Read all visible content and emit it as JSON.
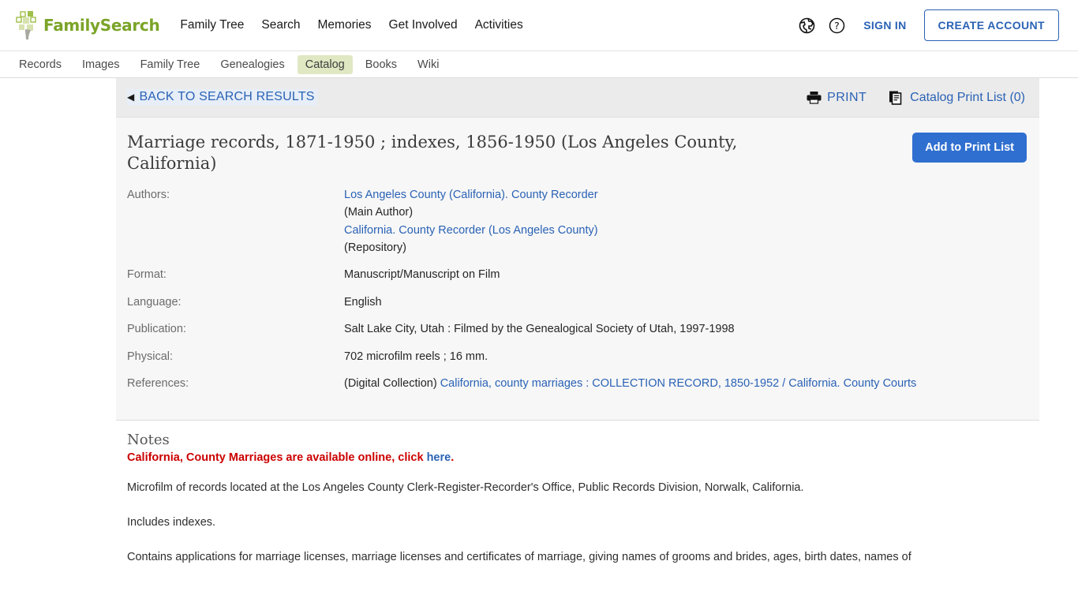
{
  "header": {
    "logo_text": "FamilySearch",
    "nav": [
      {
        "label": "Family Tree"
      },
      {
        "label": "Search"
      },
      {
        "label": "Memories"
      },
      {
        "label": "Get Involved"
      },
      {
        "label": "Activities"
      }
    ],
    "globe_icon": "globe-icon",
    "help_icon": "question-circle-icon",
    "sign_in": "SIGN IN",
    "create_account": "CREATE ACCOUNT",
    "accent_link_color": "#2a62b5",
    "logo_color": "#7ba428"
  },
  "subnav": {
    "items": [
      {
        "label": "Records",
        "active": false
      },
      {
        "label": "Images",
        "active": false
      },
      {
        "label": "Family Tree",
        "active": false
      },
      {
        "label": "Genealogies",
        "active": false
      },
      {
        "label": "Catalog",
        "active": true
      },
      {
        "label": "Books",
        "active": false
      },
      {
        "label": "Wiki",
        "active": false
      }
    ],
    "active_background": "#dfe8c2"
  },
  "toolbar": {
    "back_label": "BACK TO SEARCH RESULTS",
    "back_arrow": "◀",
    "print_label": "PRINT",
    "print_icon": "printer-icon",
    "print_list_label": "Catalog Print List (0)",
    "print_list_icon": "document-stack-icon"
  },
  "record": {
    "title": "Marriage records, 1871-1950 ; indexes, 1856-1950 (Los Angeles County, California)",
    "add_button": "Add to Print List",
    "add_button_color": "#2f6fd0",
    "fields": [
      {
        "label": "Authors:",
        "lines": [
          {
            "text": "Los Angeles County (California). County Recorder",
            "link": true
          },
          {
            "text": "(Main Author)",
            "link": false
          },
          {
            "text": "California. County Recorder (Los Angeles County)",
            "link": true
          },
          {
            "text": "(Repository)",
            "link": false
          }
        ]
      },
      {
        "label": "Format:",
        "lines": [
          {
            "text": "Manuscript/Manuscript on Film",
            "link": false
          }
        ]
      },
      {
        "label": "Language:",
        "lines": [
          {
            "text": "English",
            "link": false
          }
        ]
      },
      {
        "label": "Publication:",
        "lines": [
          {
            "text": "Salt Lake City, Utah : Filmed by the Genealogical Society of Utah, 1997-1998",
            "link": false
          }
        ]
      },
      {
        "label": "Physical:",
        "lines": [
          {
            "text": "702 microfilm reels ; 16 mm.",
            "link": false
          }
        ]
      },
      {
        "label": "References:",
        "lines": [
          {
            "text": "(Digital Collection) ",
            "link": false
          },
          {
            "text": "California, county marriages : COLLECTION RECORD, 1850-1952 / California. County Courts",
            "link": true
          }
        ]
      }
    ]
  },
  "notes": {
    "heading": "Notes",
    "alert_prefix": "California, County Marriages are available online, click ",
    "alert_link": "here",
    "alert_suffix": ".",
    "alert_color": "#cc0000",
    "paragraphs": [
      "Microfilm of records located at the Los Angeles County Clerk-Register-Recorder's Office, Public Records Division, Norwalk, California.",
      "Includes indexes.",
      "Contains applications for marriage licenses, marriage licenses and certificates of marriage, giving names of grooms and brides, ages, birth dates, names of"
    ]
  }
}
